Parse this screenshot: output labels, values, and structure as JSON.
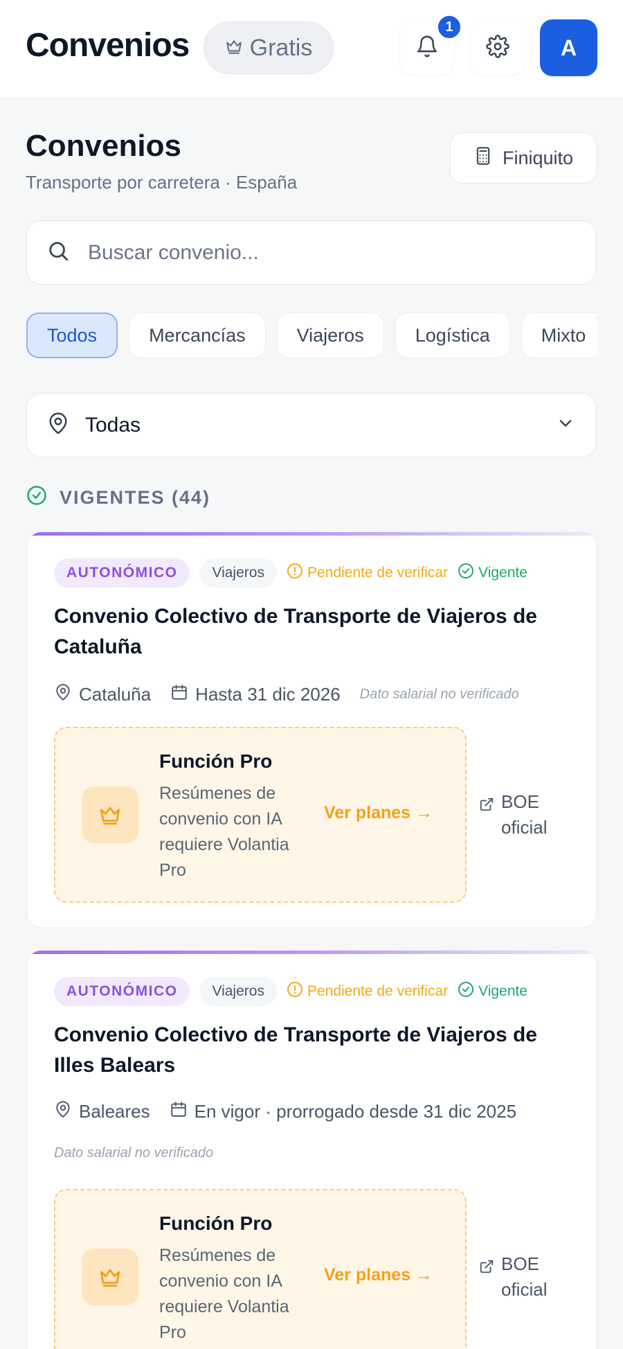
{
  "header": {
    "brand": "Convenios",
    "plan_label": "Gratis",
    "notification_count": "1",
    "avatar_initial": "A"
  },
  "page": {
    "title": "Convenios",
    "subtitle": "Transporte por carretera · España",
    "finiquito_label": "Finiquito"
  },
  "search": {
    "placeholder": "Buscar convenio..."
  },
  "filters": {
    "chips": [
      "Todos",
      "Mercancías",
      "Viajeros",
      "Logística",
      "Mixto"
    ],
    "active_index": 0
  },
  "region": {
    "selected": "Todas"
  },
  "section": {
    "label": "VIGENTES (44)"
  },
  "cards": [
    {
      "scope": "AUTONÓMICO",
      "type": "Viajeros",
      "pending": "Pendiente de verificar",
      "status": "Vigente",
      "title": "Convenio Colectivo de Transporte de Viajeros de Cataluña",
      "region": "Cataluña",
      "validity": "Hasta 31 dic 2026",
      "unverified": "Dato salarial no verificado",
      "pro_title": "Función Pro",
      "pro_desc": "Resúmenes de convenio con IA requiere Volantia Pro",
      "pro_link": "Ver planes →",
      "boe": "BOE oficial"
    },
    {
      "scope": "AUTONÓMICO",
      "type": "Viajeros",
      "pending": "Pendiente de verificar",
      "status": "Vigente",
      "title": "Convenio Colectivo de Transporte de Viajeros de Illes Balears",
      "region": "Baleares",
      "validity": "En vigor · prorrogado desde 31 dic 2025",
      "unverified": "Dato salarial no verificado",
      "pro_title": "Función Pro",
      "pro_desc": "Resúmenes de convenio con IA requiere Volantia Pro",
      "pro_link": "Ver planes →",
      "boe": "BOE oficial"
    }
  ],
  "colors": {
    "primary": "#1a5fe0",
    "purple": "#8b4fe4",
    "amber": "#f2a11a",
    "green": "#1ea86b"
  },
  "icons": [
    "crown-icon",
    "bell-icon",
    "gear-icon",
    "calculator-icon",
    "search-icon",
    "map-pin-icon",
    "chevron-down-icon",
    "check-circle-icon",
    "alert-circle-icon",
    "calendar-icon",
    "external-link-icon"
  ]
}
